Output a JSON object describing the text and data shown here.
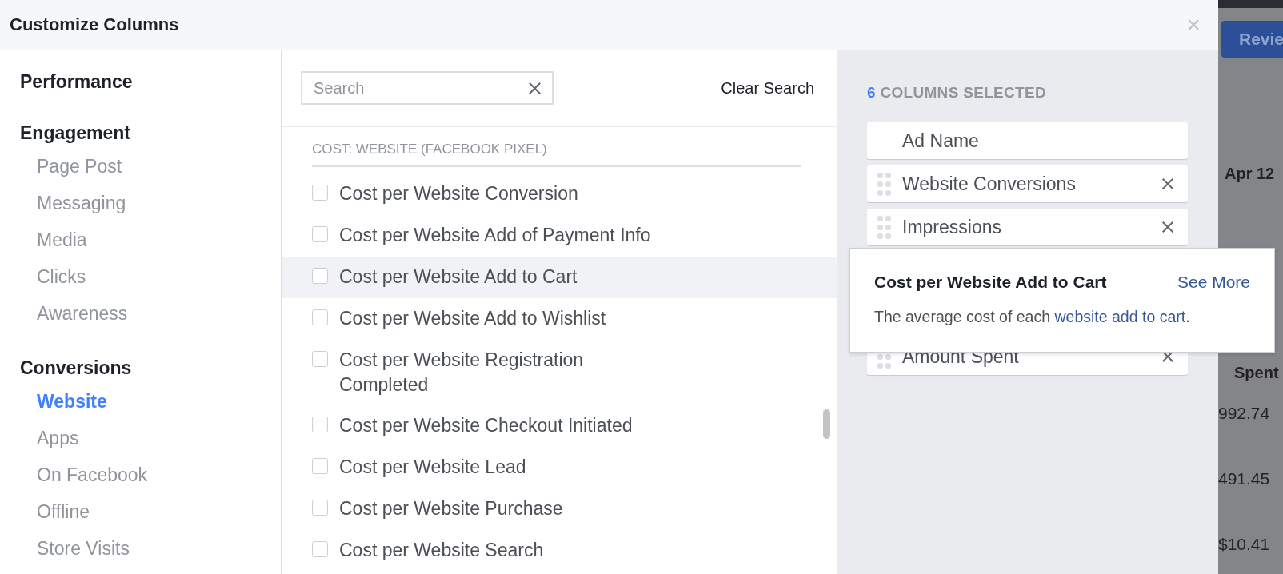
{
  "dialog": {
    "title": "Customize Columns",
    "close": "×"
  },
  "nav": [
    {
      "heading": "Performance"
    },
    {
      "heading": "Engagement",
      "items": [
        {
          "label": "Page Post",
          "selected": false
        },
        {
          "label": "Messaging",
          "selected": false
        },
        {
          "label": "Media",
          "selected": false
        },
        {
          "label": "Clicks",
          "selected": false
        },
        {
          "label": "Awareness",
          "selected": false
        }
      ]
    },
    {
      "heading": "Conversions",
      "items": [
        {
          "label": "Website",
          "selected": true
        },
        {
          "label": "Apps",
          "selected": false
        },
        {
          "label": "On Facebook",
          "selected": false
        },
        {
          "label": "Offline",
          "selected": false
        },
        {
          "label": "Store Visits",
          "selected": false
        }
      ]
    }
  ],
  "search": {
    "placeholder": "Search",
    "clear": "Clear Search"
  },
  "section": "COST: WEBSITE (FACEBOOK PIXEL)",
  "metrics": [
    {
      "label": "Cost per Website Conversion",
      "checked": false,
      "hovered": false
    },
    {
      "label": "Cost per Website Add of Payment Info",
      "checked": false,
      "hovered": false
    },
    {
      "label": "Cost per Website Add to Cart",
      "checked": false,
      "hovered": true
    },
    {
      "label": "Cost per Website Add to Wishlist",
      "checked": false,
      "hovered": false
    },
    {
      "label": "Cost per Website Registration Completed",
      "checked": false,
      "hovered": false
    },
    {
      "label": "Cost per Website Checkout Initiated",
      "checked": false,
      "hovered": false
    },
    {
      "label": "Cost per Website Lead",
      "checked": false,
      "hovered": false
    },
    {
      "label": "Cost per Website Purchase",
      "checked": false,
      "hovered": false
    },
    {
      "label": "Cost per Website Search",
      "checked": false,
      "hovered": false
    }
  ],
  "selected_summary": {
    "count": "6",
    "label": "COLUMNS SELECTED"
  },
  "columns": [
    {
      "label": "Ad Name",
      "removable": false
    },
    {
      "label": "Website Conversions",
      "removable": true
    },
    {
      "label": "Impressions",
      "removable": true
    },
    {
      "label": "Amount Spent",
      "removable": true
    }
  ],
  "tooltip": {
    "title": "Cost per Website Add to Cart",
    "see_more": "See More",
    "text_before": "The average cost of each",
    "link": "website add to cart",
    "text_after": "."
  },
  "background": {
    "button": "Revie",
    "date": "Apr 12",
    "column": "Spent",
    "values": [
      "992.74",
      "491.45",
      "$10.41"
    ]
  }
}
